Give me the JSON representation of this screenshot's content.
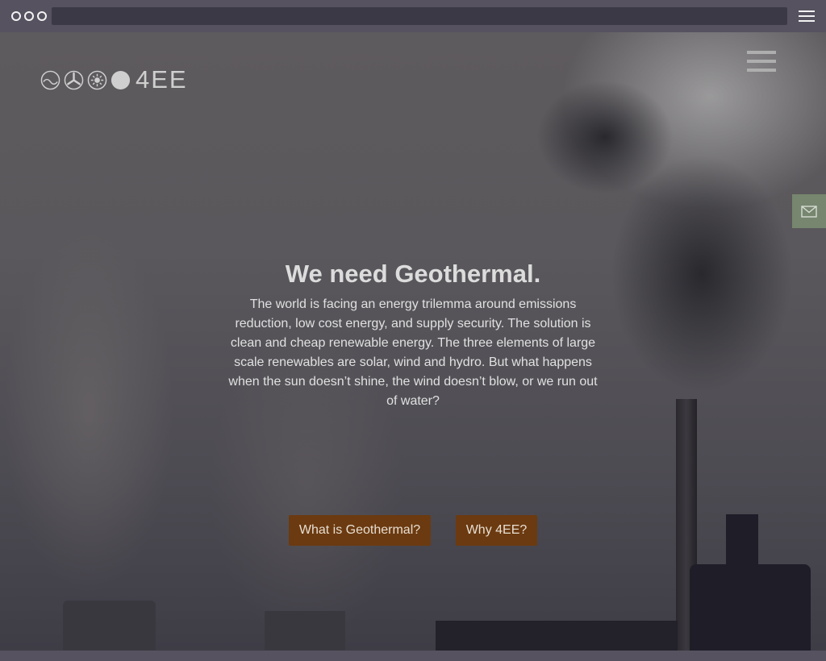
{
  "site": {
    "logo_text": "4EE",
    "logo_icons": [
      "geothermal-icon",
      "wind-icon",
      "solar-icon",
      "hydro-icon"
    ]
  },
  "hero": {
    "headline": "We need Geothermal.",
    "intro": "The world is facing an energy trilemma around emissions reduction, low cost energy, and supply security. The solution is clean and cheap renewable energy. The three elements of large scale renewables are solar, wind and hydro. But what happens when the sun doesn’t shine, the wind doesn’t blow, or we run out of water?",
    "buttons": [
      {
        "label": "What is Geothermal?"
      },
      {
        "label": "Why 4EE?"
      }
    ]
  },
  "colors": {
    "button_bg": "#6b3a10",
    "mail_tab_bg": "#77866f",
    "text": "#dcdcdc"
  }
}
